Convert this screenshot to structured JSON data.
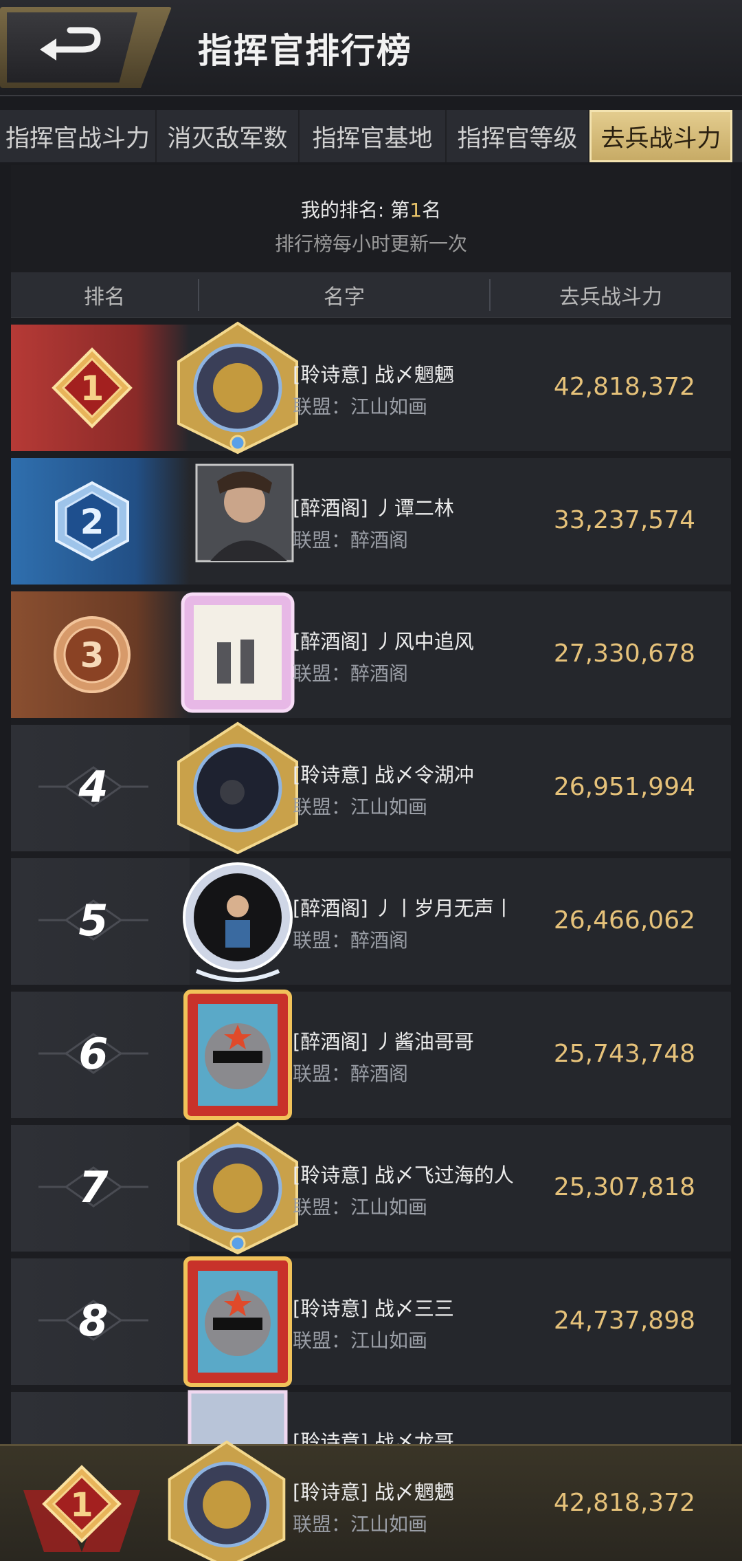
{
  "header": {
    "title": "指挥官排行榜"
  },
  "tabs": [
    {
      "label": "指挥官战斗力",
      "active": false
    },
    {
      "label": "消灭敌军数",
      "active": false
    },
    {
      "label": "指挥官基地",
      "active": false
    },
    {
      "label": "指挥官等级",
      "active": false
    },
    {
      "label": "去兵战斗力",
      "active": true
    }
  ],
  "my_rank": {
    "prefix": "我的排名: 第",
    "value": "1",
    "suffix": "名",
    "note": "排行榜每小时更新一次"
  },
  "columns": {
    "rank": "排名",
    "name": "名字",
    "power": "去兵战斗力"
  },
  "rows": [
    {
      "rank": "1",
      "name": "[聆诗意] 战〆魍魉",
      "alliance": "联盟：江山如画",
      "power": "42,818,372",
      "tier": "gold"
    },
    {
      "rank": "2",
      "name": "[醉酒阁] 丿谭二林",
      "alliance": "联盟：醉酒阁",
      "power": "33,237,574",
      "tier": "silver"
    },
    {
      "rank": "3",
      "name": "[醉酒阁] 丿风中追风",
      "alliance": "联盟：醉酒阁",
      "power": "27,330,678",
      "tier": "bronze"
    },
    {
      "rank": "4",
      "name": "[聆诗意] 战〆令湖冲",
      "alliance": "联盟：江山如画",
      "power": "26,951,994",
      "tier": "plain"
    },
    {
      "rank": "5",
      "name": "[醉酒阁] 丿丨岁月无声丨",
      "alliance": "联盟：醉酒阁",
      "power": "26,466,062",
      "tier": "plain"
    },
    {
      "rank": "6",
      "name": "[醉酒阁] 丿酱油哥哥",
      "alliance": "联盟：醉酒阁",
      "power": "25,743,748",
      "tier": "plain"
    },
    {
      "rank": "7",
      "name": "[聆诗意] 战〆飞过海的人",
      "alliance": "联盟：江山如画",
      "power": "25,307,818",
      "tier": "plain"
    },
    {
      "rank": "8",
      "name": "[聆诗意] 战〆三三",
      "alliance": "联盟：江山如画",
      "power": "24,737,898",
      "tier": "plain"
    }
  ],
  "partial_row": {
    "name": "[聆诗意] 战〆龙哥"
  },
  "my_entry": {
    "rank": "1",
    "name": "[聆诗意] 战〆魍魉",
    "alliance": "联盟：江山如画",
    "power": "42,818,372"
  },
  "colors": {
    "gold_text": "#e6c27a",
    "active_tab": "#d8bd78"
  }
}
